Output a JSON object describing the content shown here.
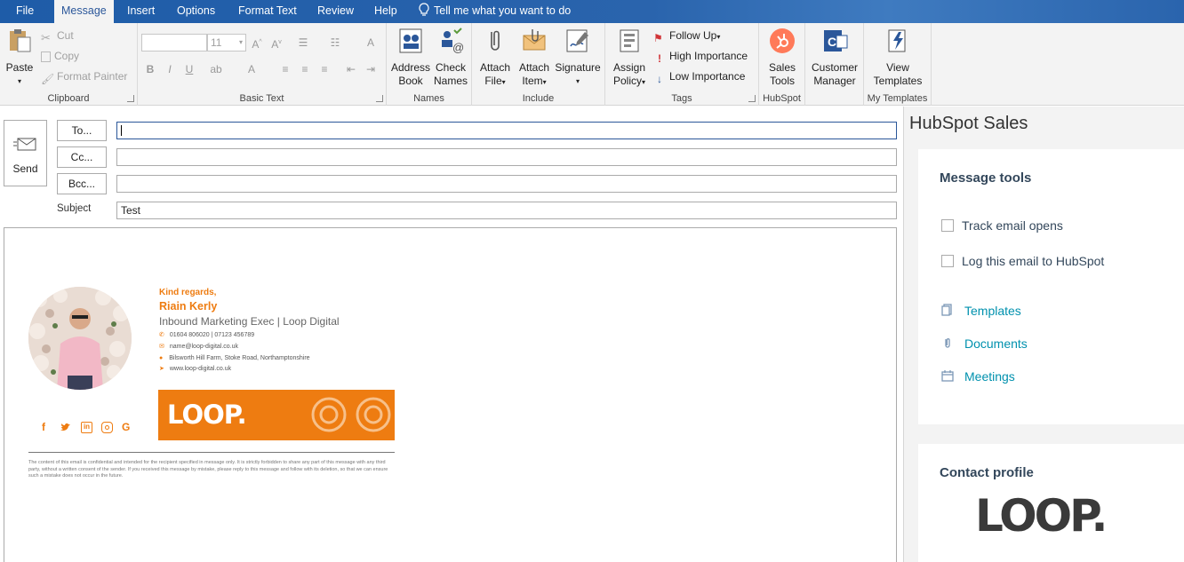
{
  "menu": {
    "tabs": [
      {
        "label": "File"
      },
      {
        "label": "Message"
      },
      {
        "label": "Insert"
      },
      {
        "label": "Options"
      },
      {
        "label": "Format Text"
      },
      {
        "label": "Review"
      },
      {
        "label": "Help"
      }
    ],
    "tell_me": "Tell me what you want to do"
  },
  "ribbon": {
    "clipboard": {
      "paste": "Paste",
      "cut": "Cut",
      "copy": "Copy",
      "format_painter": "Format Painter",
      "label": "Clipboard"
    },
    "basic_text": {
      "font_size": "11",
      "bold": "B",
      "italic": "I",
      "underline": "U",
      "label": "Basic Text"
    },
    "names": {
      "address_book_1": "Address",
      "address_book_2": "Book",
      "check_names_1": "Check",
      "check_names_2": "Names",
      "label": "Names"
    },
    "include": {
      "attach_file_1": "Attach",
      "attach_file_2": "File",
      "attach_item_1": "Attach",
      "attach_item_2": "Item",
      "signature": "Signature",
      "label": "Include"
    },
    "tags": {
      "assign_policy_1": "Assign",
      "assign_policy_2": "Policy",
      "follow_up": "Follow Up",
      "high_importance": "High Importance",
      "low_importance": "Low Importance",
      "label": "Tags"
    },
    "hubspot": {
      "sales_tools_1": "Sales",
      "sales_tools_2": "Tools",
      "label": "HubSpot"
    },
    "customer_manager": {
      "l1": "Customer",
      "l2": "Manager"
    },
    "my_templates": {
      "view_1": "View",
      "view_2": "Templates",
      "label": "My Templates"
    }
  },
  "compose": {
    "send": "Send",
    "to_button": "To...",
    "cc_button": "Cc...",
    "bcc_button": "Bcc...",
    "to_value": "",
    "cc_value": "",
    "bcc_value": "",
    "subject_label": "Subject",
    "subject_value": "Test"
  },
  "signature": {
    "greeting": "Kind regards,",
    "name": "Riain Kerly",
    "role": "Inbound Marketing Exec | Loop Digital",
    "phone": "01604 806020 | 07123 456789",
    "email": "name@loop-digital.co.uk",
    "address": "Bilsworth Hill Farm, Stoke Road, Northamptonshire",
    "website": "www.loop-digital.co.uk",
    "banner_logo": "LOOP.",
    "disclaimer": "The content of this email is confidential and intended for the recipient specified in message only. It is strictly forbidden to share any part of this message with any third party, without a written consent of the sender. If you received this message by mistake, please reply to this message and follow with its deletion, so that we can ensure such a mistake does not occur in the future.",
    "socials": [
      "f",
      "twitter",
      "in",
      "instagram",
      "G"
    ]
  },
  "hubspot_pane": {
    "title": "HubSpot Sales",
    "message_tools": {
      "heading": "Message tools",
      "track": "Track email opens",
      "log": "Log this email to HubSpot",
      "templates": "Templates",
      "documents": "Documents",
      "meetings": "Meetings"
    },
    "contact_profile": {
      "heading": "Contact profile",
      "logo_text": "LOOP."
    }
  },
  "colors": {
    "accent": "#2b579a",
    "brand_orange": "#ee7c11",
    "hubspot_orange": "#ff7a59",
    "link": "#0091ae"
  }
}
